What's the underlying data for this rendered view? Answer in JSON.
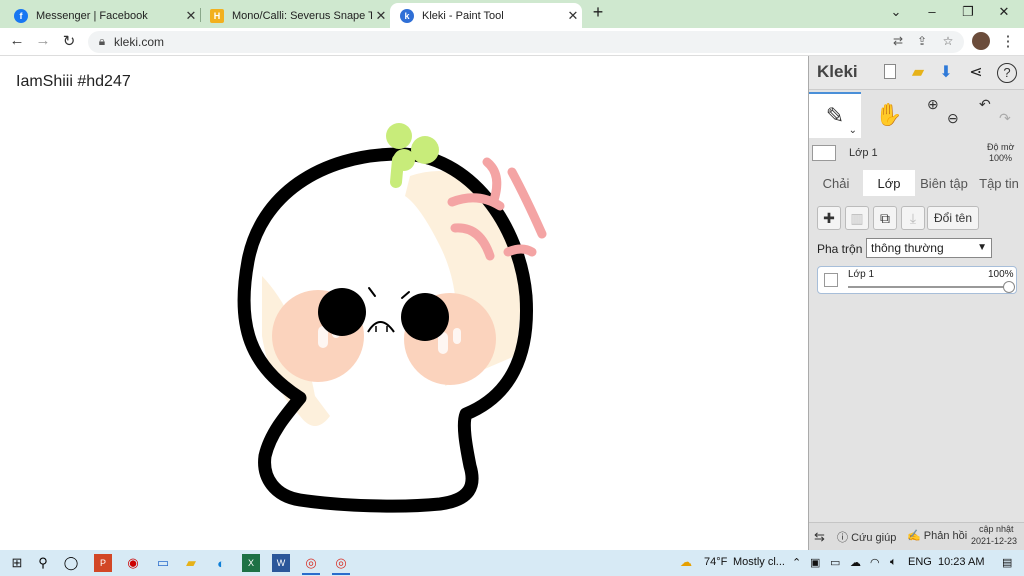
{
  "browser": {
    "tabs": [
      {
        "title": "Messenger | Facebook",
        "icon": "facebook-icon",
        "active": false
      },
      {
        "title": "Mono/Calli: Severus Snape Tone",
        "icon": "hammer-icon",
        "active": false
      },
      {
        "title": "Kleki - Paint Tool",
        "icon": "kleki-icon",
        "active": true
      }
    ],
    "new_tab": "+",
    "url": "kleki.com"
  },
  "canvas": {
    "caption": "IamShiii #hd247"
  },
  "panel": {
    "logo": "Kleki",
    "current_layer_name": "Lớp 1",
    "opacity_label": "Độ mờ",
    "opacity_value": "100%",
    "tabs": [
      "Chải",
      "Lớp",
      "Biên tập",
      "Tập tin"
    ],
    "active_tab": "Lớp",
    "rename_label": "Đổi tên",
    "blend_label": "Pha trộn",
    "blend_value": "thông thường",
    "layers": [
      {
        "name": "Lớp 1",
        "opacity": "100%"
      }
    ],
    "bottom": {
      "help": "Cứu giúp",
      "feedback": "Phản hồi",
      "update_label": "cập nhật",
      "update_date": "2021-12-23"
    }
  },
  "taskbar": {
    "weather": "74°F",
    "weather_desc": "Mostly cl...",
    "lang": "ENG",
    "time": "10:23 AM"
  },
  "colors": {
    "tabstrip": "#cfe8cf",
    "taskbar": "#d7eaf5",
    "accent_blue": "#2a6dcc",
    "character_outline": "#000000",
    "sprout": "#c8ec7a",
    "anger": "#f4a4a4",
    "cheek": "#fbd3bd",
    "shade": "#fdf0dc"
  }
}
